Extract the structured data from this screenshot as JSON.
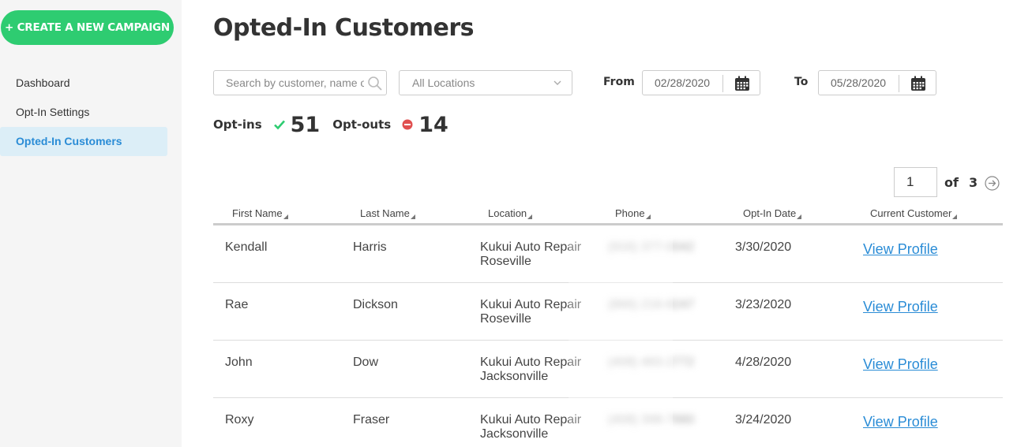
{
  "sidebar": {
    "create_button": "+ CREATE A NEW CAMPAIGN",
    "items": [
      {
        "label": "Dashboard",
        "active": false
      },
      {
        "label": "Opt-In Settings",
        "active": false
      },
      {
        "label": "Opted-In Customers",
        "active": true
      }
    ]
  },
  "page": {
    "title": "Opted-In Customers"
  },
  "filters": {
    "search_placeholder": "Search by customer, name or phone",
    "location": "All Locations",
    "from_label": "From",
    "from_date": "02/28/2020",
    "to_label": "To",
    "to_date": "05/28/2020"
  },
  "stats": {
    "optins_label": "Opt-ins",
    "optins_count": "51",
    "optouts_label": "Opt-outs",
    "optouts_count": "14"
  },
  "pager": {
    "current": "1",
    "of_label": "of",
    "total": "3"
  },
  "table": {
    "headers": [
      "First Name",
      "Last Name",
      "Location",
      "Phone",
      "Opt-In Date",
      "Current Customer"
    ],
    "rows": [
      {
        "first": "Kendall",
        "last": "Harris",
        "loc1": "Kukui Auto Repair",
        "loc2": "Roseville",
        "phone": "(916) 377-0042",
        "date": "3/30/2020",
        "action": "View Profile"
      },
      {
        "first": "Rae",
        "last": "Dickson",
        "loc1": "Kukui Auto Repair",
        "loc2": "Roseville",
        "phone": "(866) 216-8247",
        "date": "3/23/2020",
        "action": "View Profile"
      },
      {
        "first": "John",
        "last": "Dow",
        "loc1": "Kukui Auto Repair",
        "loc2": "Jacksonville",
        "phone": "(408) 483-2772",
        "date": "4/28/2020",
        "action": "View Profile"
      },
      {
        "first": "Roxy",
        "last": "Fraser",
        "loc1": "Kukui Auto Repair",
        "loc2": "Jacksonville",
        "phone": "(408) 398-7880",
        "date": "3/24/2020",
        "action": "View Profile"
      }
    ]
  },
  "colors": {
    "accent_green": "#2ecc71",
    "link_blue": "#2a8cd6",
    "optout_red": "#e05050"
  }
}
